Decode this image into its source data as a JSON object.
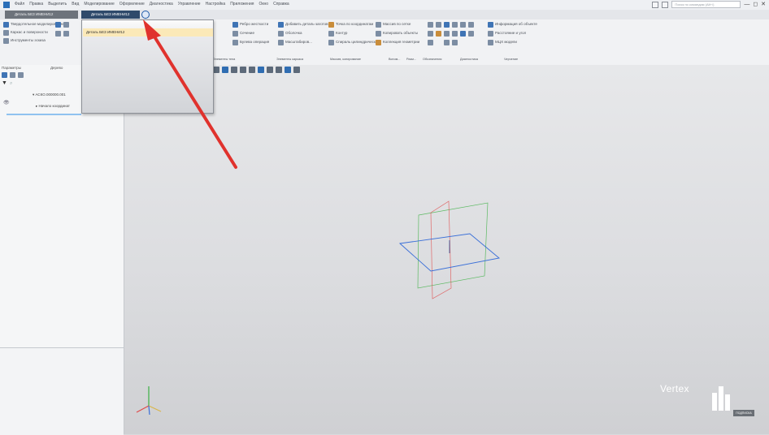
{
  "app": {
    "menu": [
      "Файл",
      "Правка",
      "Выделить",
      "Вид",
      "Моделирование",
      "Оформление",
      "Диагностика",
      "Управление",
      "Настройка",
      "Приложения",
      "Окно",
      "Справка"
    ],
    "search_placeholder": "Поиск по командам (Alt+/)",
    "window_controls": [
      "—",
      "◻",
      "✕"
    ]
  },
  "tabs": {
    "doc1": "Деталь БЕЗ ИМЕНИ12",
    "doc2": "Деталь БЕЗ ИМЕНИ12"
  },
  "dropdown": {
    "item": "Деталь БЕЗ ИМЕНИ12"
  },
  "ribbon": {
    "left_tools": [
      "Твердотельное моделирование",
      "Каркас и поверхности",
      "Инструменты эскиза"
    ],
    "col_a": [
      "Ребро жесткости",
      "Сечение",
      "Булева операция"
    ],
    "col_b": [
      "Добавить деталь-заготов...",
      "Оболочка",
      "Масштабиров..."
    ],
    "col_c": [
      "Точка по координатам",
      "Контур",
      "Спираль цилиндрическ..."
    ],
    "col_d": [
      "Массив по сетке",
      "Копировать объекты",
      "Коллекция геометрии"
    ],
    "col_e": [
      "Информация об объекте",
      "Расстояние и угол",
      "МЦХ модели"
    ],
    "groups": [
      "Элементы тела",
      "Элементы каркаса",
      "Массив, копирование",
      "Вспом...",
      "Разм...",
      "Обозначения",
      "Диагностика",
      "Черчение"
    ]
  },
  "tree": {
    "tabs": [
      "Параметры",
      "Дерево"
    ],
    "root": "АСКО.000000.001",
    "child": "Начало координат"
  },
  "watermark": {
    "brand": "Vertex",
    "badge": "ПОДПИСКА"
  },
  "colors": {
    "arrow": "#e0322d",
    "plane_xy": "#3a6fd8",
    "plane_zx": "#e04a4a",
    "plane_yz": "#3cb043",
    "active_tab": "#2f4a6b"
  }
}
